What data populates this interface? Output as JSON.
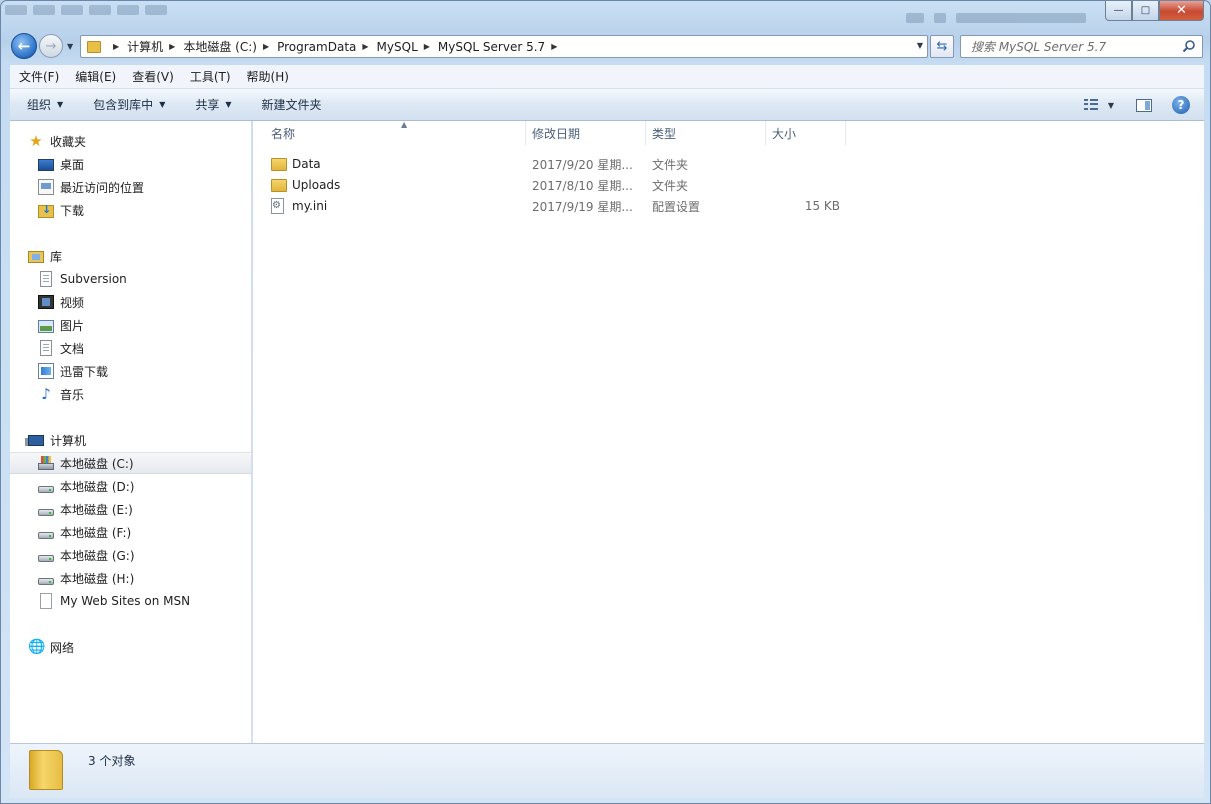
{
  "window": {
    "minimize_glyph": "—",
    "maximize_glyph": "□",
    "close_glyph": "✕"
  },
  "nav": {
    "back_glyph": "←",
    "forward_glyph": "→",
    "refresh_glyph": "⇆"
  },
  "address_bar": {
    "crumbs": [
      "计算机",
      "本地磁盘 (C:)",
      "ProgramData",
      "MySQL",
      "MySQL Server 5.7"
    ]
  },
  "search": {
    "placeholder": "搜索 MySQL Server 5.7"
  },
  "menu": {
    "items": [
      "文件(F)",
      "编辑(E)",
      "查看(V)",
      "工具(T)",
      "帮助(H)"
    ]
  },
  "toolbar": {
    "organize": "组织",
    "include_in_library": "包含到库中",
    "share": "共享",
    "new_folder": "新建文件夹",
    "help_glyph": "?"
  },
  "sidebar": {
    "favorites": {
      "label": "收藏夹",
      "items": [
        "桌面",
        "最近访问的位置",
        "下载"
      ]
    },
    "libraries": {
      "label": "库",
      "items": [
        "Subversion",
        "视频",
        "图片",
        "文档",
        "迅雷下载",
        "音乐"
      ]
    },
    "computer": {
      "label": "计算机",
      "items": [
        "本地磁盘 (C:)",
        "本地磁盘 (D:)",
        "本地磁盘 (E:)",
        "本地磁盘 (F:)",
        "本地磁盘 (G:)",
        "本地磁盘 (H:)",
        "My Web Sites on MSN"
      ]
    },
    "network": {
      "label": "网络"
    }
  },
  "file_list": {
    "columns": [
      "名称",
      "修改日期",
      "类型",
      "大小"
    ],
    "rows": [
      {
        "name": "Data",
        "modified": "2017/9/20 星期...",
        "type": "文件夹",
        "size": ""
      },
      {
        "name": "Uploads",
        "modified": "2017/8/10 星期...",
        "type": "文件夹",
        "size": ""
      },
      {
        "name": "my.ini",
        "modified": "2017/9/19 星期...",
        "type": "配置设置",
        "size": "15 KB"
      }
    ]
  },
  "details_pane": {
    "item_count": "3 个对象"
  }
}
